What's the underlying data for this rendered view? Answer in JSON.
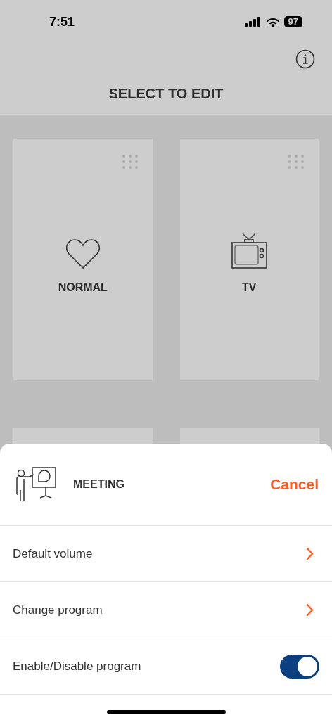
{
  "status_bar": {
    "time": "7:51",
    "battery": "97"
  },
  "header": {
    "title": "SELECT TO EDIT"
  },
  "programs": [
    {
      "label": "NORMAL",
      "kind": "heart"
    },
    {
      "label": "TV",
      "kind": "tv"
    },
    {
      "kind": "blank"
    },
    {
      "kind": "blank"
    }
  ],
  "sheet": {
    "program": "MEETING",
    "cancel": "Cancel",
    "options": [
      {
        "label": "Default volume",
        "kind": "link"
      },
      {
        "label": "Change program",
        "kind": "link"
      },
      {
        "label": "Enable/Disable program",
        "kind": "toggle",
        "on": true
      }
    ]
  }
}
